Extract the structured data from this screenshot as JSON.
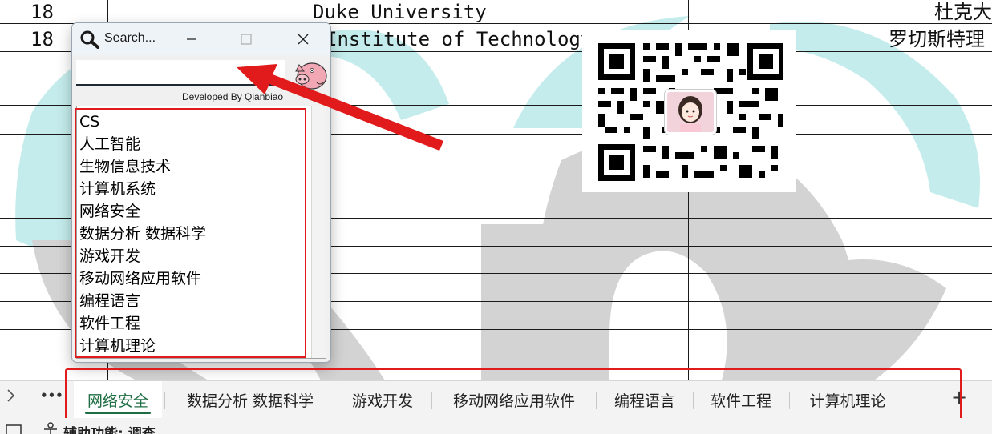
{
  "sheet": {
    "rows": [
      {
        "num": "18",
        "english": "Duke University",
        "chinese": "杜克大"
      },
      {
        "num": "18",
        "english": "Institute of Technology",
        "chinese": "罗切斯特理"
      }
    ]
  },
  "dialog": {
    "title": "Search...",
    "search_value": "",
    "developer_credit": "Developed By Qianbiao",
    "list_items": [
      "CS",
      "人工智能",
      "生物信息技术",
      "计算机系统",
      "网络安全",
      "数据分析 数据科学",
      "游戏开发",
      "移动网络应用软件",
      "编程语言",
      "软件工程",
      "计算机理论"
    ]
  },
  "sheet_tabs": {
    "more": "•••",
    "add": "+",
    "items": [
      "网络安全",
      "数据分析 数据科学",
      "游戏开发",
      "移动网络应用软件",
      "编程语言",
      "软件工程",
      "计算机理论"
    ],
    "active_index": 0
  },
  "status_bar": {
    "text": "辅助功能: 调查"
  },
  "colors": {
    "annotation_red": "#e11b1b",
    "active_tab_green": "#1f6e43",
    "watermark_teal": "#c4ecec",
    "watermark_gray": "#d3d3d3"
  },
  "icons": [
    "search-icon",
    "minimize-icon",
    "maximize-icon",
    "close-icon",
    "pig-logo",
    "qr-code",
    "chevron-right-icon",
    "more-icon",
    "add-sheet-icon",
    "accessibility-icon"
  ]
}
